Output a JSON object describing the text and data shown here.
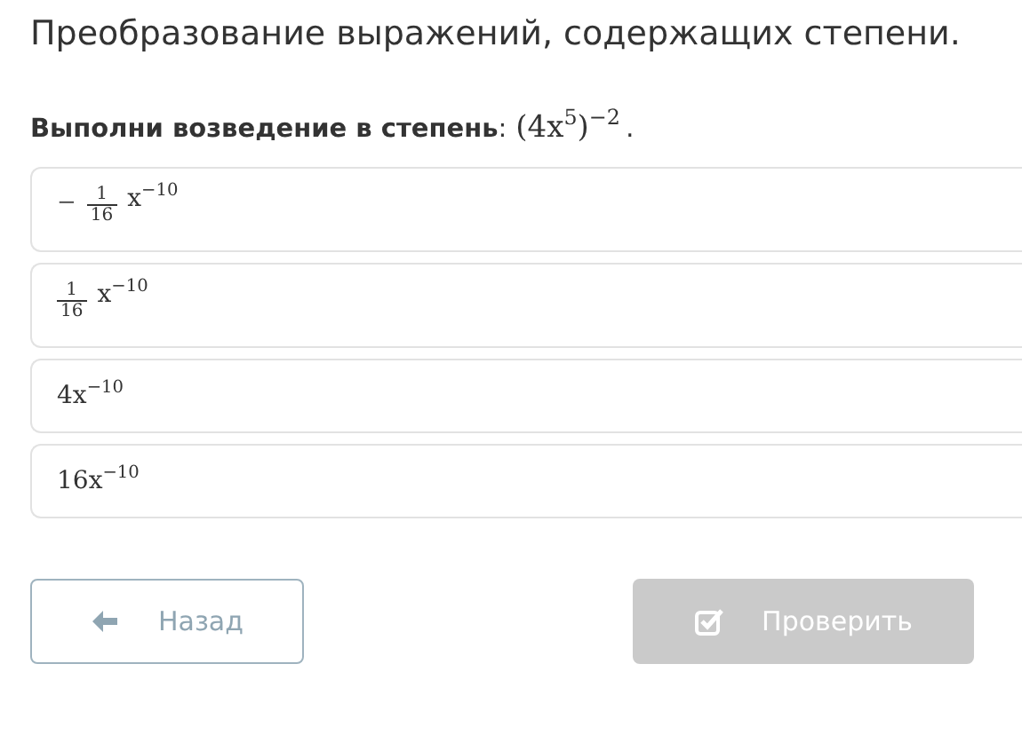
{
  "title": "Преобразование выражений, содержащих степени.",
  "question": {
    "label": "Выполни возведение в степень",
    "colon": ":",
    "expression": "(4x$^{5}$)$^{−2}$",
    "end": "."
  },
  "options": [
    {
      "kind": "fraction",
      "sign": "−",
      "numerator": "1",
      "denominator": "16",
      "expression": "x$^{−10}$"
    },
    {
      "kind": "fraction",
      "numerator": "1",
      "denominator": "16",
      "expression": "x$^{−10}$"
    },
    {
      "kind": "plain",
      "expression": "4x$^{−10}$"
    },
    {
      "kind": "plain",
      "expression": "16x$^{−10}$"
    }
  ],
  "buttons": [
    {
      "kind": "back",
      "label": "Назад",
      "disabled": false
    },
    {
      "kind": "check",
      "label": "Проверить",
      "disabled": true
    }
  ]
}
